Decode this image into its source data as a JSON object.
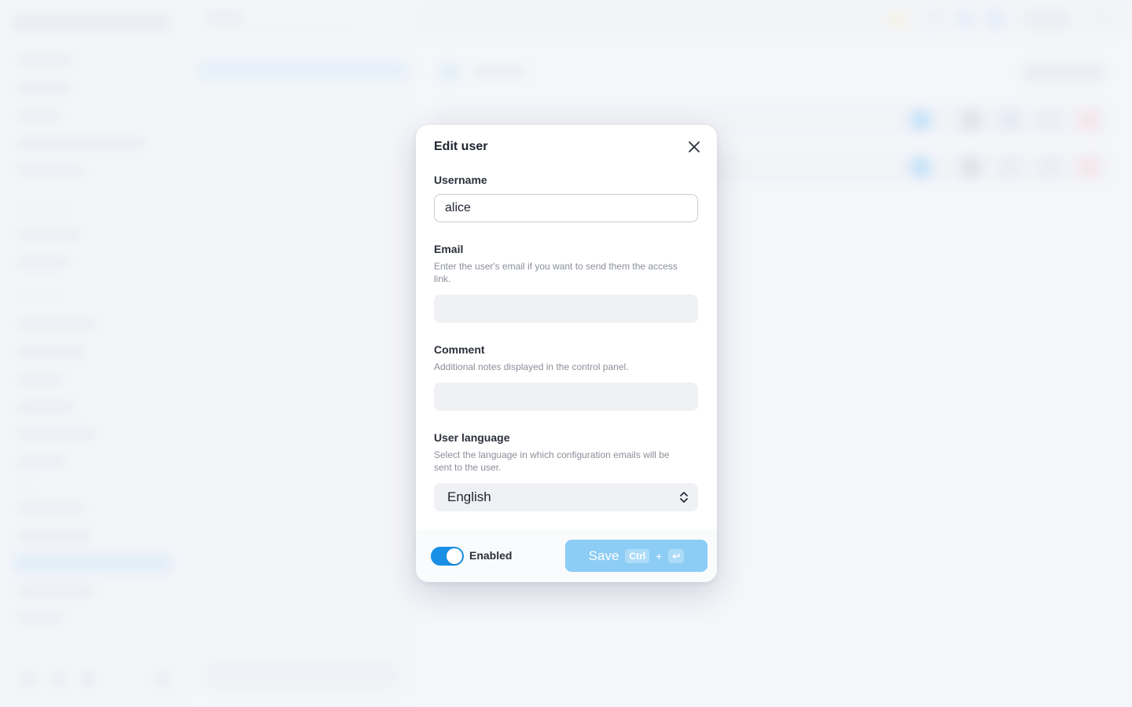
{
  "modal": {
    "title": "Edit user",
    "username": {
      "label": "Username",
      "value": "alice"
    },
    "email": {
      "label": "Email",
      "hint": "Enter the user's email if you want to send them the access link.",
      "value": ""
    },
    "comment": {
      "label": "Comment",
      "hint": "Additional notes displayed in the control panel.",
      "value": ""
    },
    "language": {
      "label": "User language",
      "hint": "Select the language in which configuration emails will be sent to the user.",
      "selected": "English"
    },
    "enabled": {
      "label": "Enabled",
      "state": true
    },
    "save": {
      "label": "Save",
      "shortcut_ctrl": "Ctrl",
      "shortcut_plus": "+",
      "shortcut_enter": "↩"
    }
  },
  "colors": {
    "accent": "#1990e6",
    "save_button": "#8dcdf5",
    "modal_bg": "#ffffff"
  },
  "icons": {
    "close": "close-icon",
    "select": "chevron-up-down-icon",
    "enter": "enter-key-icon"
  }
}
